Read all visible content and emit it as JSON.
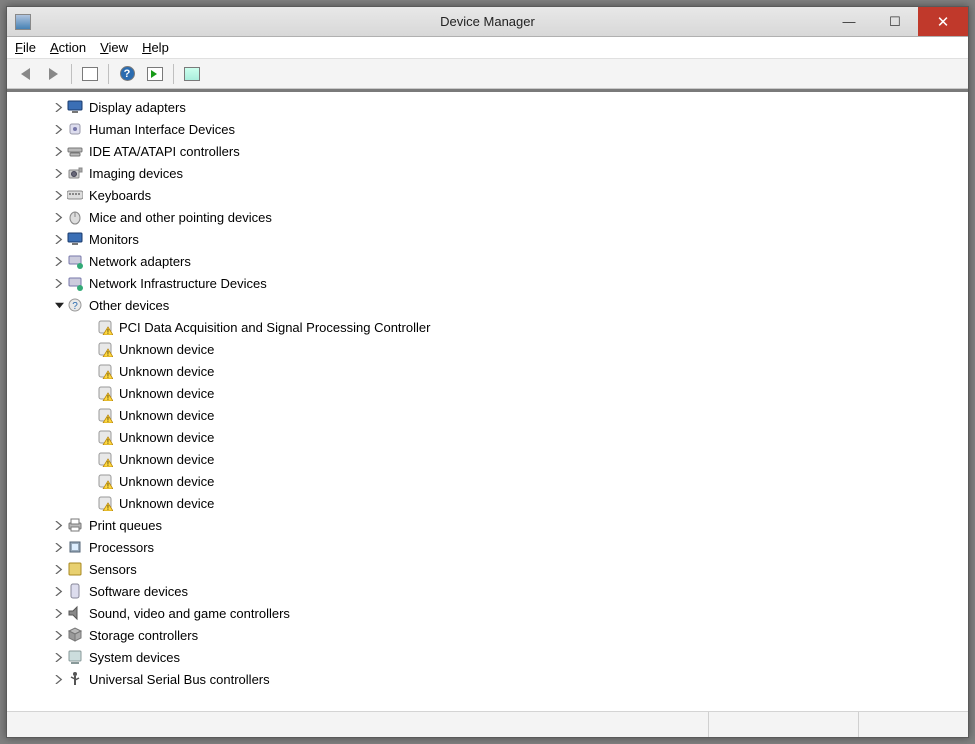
{
  "window": {
    "title": "Device Manager"
  },
  "menu": {
    "items": [
      "File",
      "Action",
      "View",
      "Help"
    ]
  },
  "toolbar": {
    "back": "back-arrow-icon",
    "forward": "forward-arrow-icon",
    "show_hide": "show-hide-console-tree-icon",
    "help": "help-icon",
    "properties": "properties-icon",
    "scan": "scan-hardware-icon"
  },
  "tree": [
    {
      "label": "Display adapters",
      "icon": "display-adapter-icon",
      "expanded": false,
      "level": 0
    },
    {
      "label": "Human Interface Devices",
      "icon": "hid-icon",
      "expanded": false,
      "level": 0
    },
    {
      "label": "IDE ATA/ATAPI controllers",
      "icon": "ide-icon",
      "expanded": false,
      "level": 0
    },
    {
      "label": "Imaging devices",
      "icon": "imaging-icon",
      "expanded": false,
      "level": 0
    },
    {
      "label": "Keyboards",
      "icon": "keyboard-icon",
      "expanded": false,
      "level": 0
    },
    {
      "label": "Mice and other pointing devices",
      "icon": "mouse-icon",
      "expanded": false,
      "level": 0
    },
    {
      "label": "Monitors",
      "icon": "monitor-icon",
      "expanded": false,
      "level": 0
    },
    {
      "label": "Network adapters",
      "icon": "network-adapter-icon",
      "expanded": false,
      "level": 0
    },
    {
      "label": "Network Infrastructure Devices",
      "icon": "network-infra-icon",
      "expanded": false,
      "level": 0
    },
    {
      "label": "Other devices",
      "icon": "other-devices-icon",
      "expanded": true,
      "level": 0
    },
    {
      "label": "PCI Data Acquisition and Signal Processing Controller",
      "icon": "unknown-device-icon",
      "expanded": null,
      "level": 1
    },
    {
      "label": "Unknown device",
      "icon": "unknown-device-icon",
      "expanded": null,
      "level": 1
    },
    {
      "label": "Unknown device",
      "icon": "unknown-device-icon",
      "expanded": null,
      "level": 1
    },
    {
      "label": "Unknown device",
      "icon": "unknown-device-icon",
      "expanded": null,
      "level": 1
    },
    {
      "label": "Unknown device",
      "icon": "unknown-device-icon",
      "expanded": null,
      "level": 1
    },
    {
      "label": "Unknown device",
      "icon": "unknown-device-icon",
      "expanded": null,
      "level": 1
    },
    {
      "label": "Unknown device",
      "icon": "unknown-device-icon",
      "expanded": null,
      "level": 1
    },
    {
      "label": "Unknown device",
      "icon": "unknown-device-icon",
      "expanded": null,
      "level": 1
    },
    {
      "label": "Unknown device",
      "icon": "unknown-device-icon",
      "expanded": null,
      "level": 1
    },
    {
      "label": "Print queues",
      "icon": "print-icon",
      "expanded": false,
      "level": 0
    },
    {
      "label": "Processors",
      "icon": "processor-icon",
      "expanded": false,
      "level": 0
    },
    {
      "label": "Sensors",
      "icon": "sensor-icon",
      "expanded": false,
      "level": 0
    },
    {
      "label": "Software devices",
      "icon": "software-icon",
      "expanded": false,
      "level": 0
    },
    {
      "label": "Sound, video and game controllers",
      "icon": "sound-icon",
      "expanded": false,
      "level": 0
    },
    {
      "label": "Storage controllers",
      "icon": "storage-icon",
      "expanded": false,
      "level": 0
    },
    {
      "label": "System devices",
      "icon": "system-icon",
      "expanded": false,
      "level": 0
    },
    {
      "label": "Universal Serial Bus controllers",
      "icon": "usb-icon",
      "expanded": false,
      "level": 0
    }
  ]
}
